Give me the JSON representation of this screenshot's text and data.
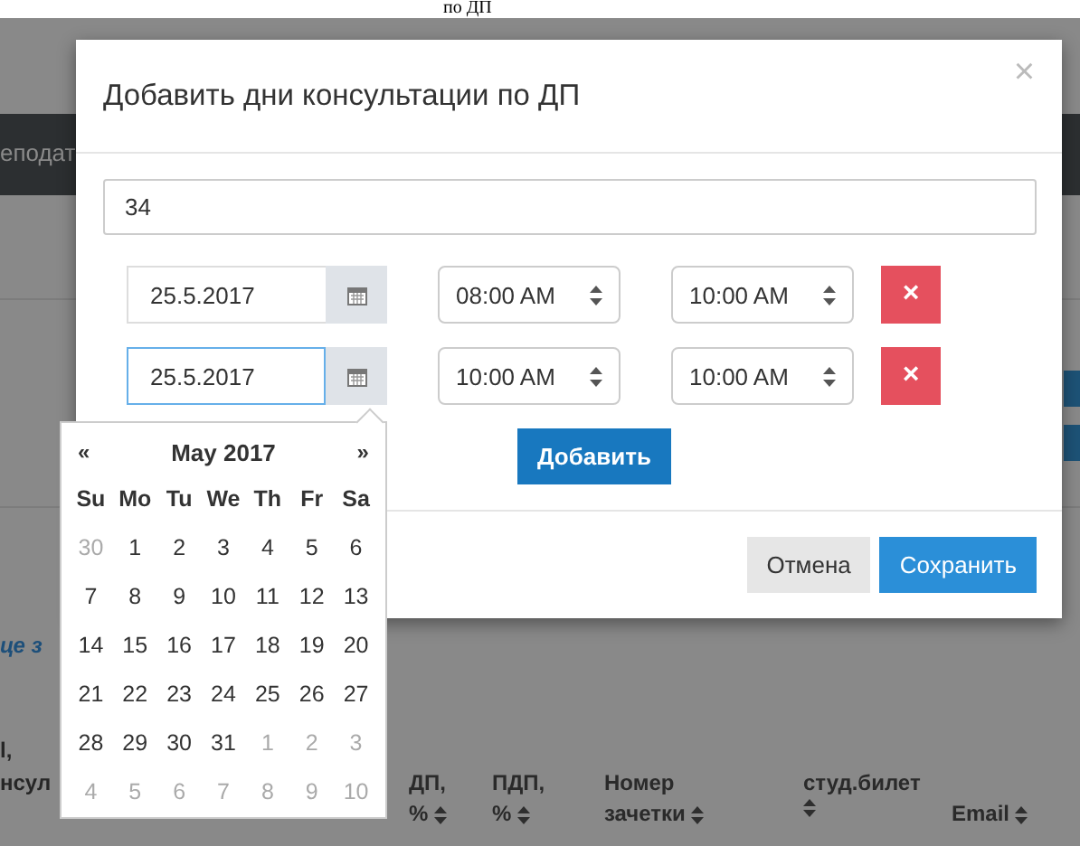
{
  "page_heading": "по ДП",
  "background": {
    "nav_text": "еподат",
    "link_text": "це з",
    "side_texts": [
      "l,",
      "нсул"
    ],
    "table_headers": [
      {
        "top": "ДП,",
        "bottom": "%"
      },
      {
        "top": "ПДП,",
        "bottom": "%"
      },
      {
        "top": "Номер",
        "bottom": "зачетки"
      },
      {
        "top": "студ.билет"
      },
      {
        "bottom": "Email"
      }
    ]
  },
  "modal": {
    "title": "Добавить дни консультации по ДП",
    "close": "×",
    "group_value": "34",
    "rows": [
      {
        "date": "25.5.2017",
        "focused": false,
        "time_from": "08:00 AM",
        "time_to": "10:00 AM",
        "remove": "×"
      },
      {
        "date": "25.5.2017",
        "focused": true,
        "time_from": "10:00 AM",
        "time_to": "10:00 AM",
        "remove": "×"
      }
    ],
    "add_button": "Добавить",
    "cancel_button": "Отмена",
    "save_button": "Сохранить"
  },
  "datepicker": {
    "prev": "«",
    "month": "May 2017",
    "next": "»",
    "weekdays": [
      "Su",
      "Mo",
      "Tu",
      "We",
      "Th",
      "Fr",
      "Sa"
    ],
    "weeks": [
      [
        {
          "day": "30",
          "other_month": true
        },
        {
          "day": "1",
          "other_month": false
        },
        {
          "day": "2",
          "other_month": false
        },
        {
          "day": "3",
          "other_month": false
        },
        {
          "day": "4",
          "other_month": false
        },
        {
          "day": "5",
          "other_month": false
        },
        {
          "day": "6",
          "other_month": false
        }
      ],
      [
        {
          "day": "7",
          "other_month": false
        },
        {
          "day": "8",
          "other_month": false
        },
        {
          "day": "9",
          "other_month": false
        },
        {
          "day": "10",
          "other_month": false
        },
        {
          "day": "11",
          "other_month": false
        },
        {
          "day": "12",
          "other_month": false
        },
        {
          "day": "13",
          "other_month": false
        }
      ],
      [
        {
          "day": "14",
          "other_month": false
        },
        {
          "day": "15",
          "other_month": false
        },
        {
          "day": "16",
          "other_month": false
        },
        {
          "day": "17",
          "other_month": false
        },
        {
          "day": "18",
          "other_month": false
        },
        {
          "day": "19",
          "other_month": false
        },
        {
          "day": "20",
          "other_month": false
        }
      ],
      [
        {
          "day": "21",
          "other_month": false
        },
        {
          "day": "22",
          "other_month": false
        },
        {
          "day": "23",
          "other_month": false
        },
        {
          "day": "24",
          "other_month": false
        },
        {
          "day": "25",
          "other_month": false
        },
        {
          "day": "26",
          "other_month": false
        },
        {
          "day": "27",
          "other_month": false
        }
      ],
      [
        {
          "day": "28",
          "other_month": false
        },
        {
          "day": "29",
          "other_month": false
        },
        {
          "day": "30",
          "other_month": false
        },
        {
          "day": "31",
          "other_month": false
        },
        {
          "day": "1",
          "other_month": true
        },
        {
          "day": "2",
          "other_month": true
        },
        {
          "day": "3",
          "other_month": true
        }
      ],
      [
        {
          "day": "4",
          "other_month": true
        },
        {
          "day": "5",
          "other_month": true
        },
        {
          "day": "6",
          "other_month": true
        },
        {
          "day": "7",
          "other_month": true
        },
        {
          "day": "8",
          "other_month": true
        },
        {
          "day": "9",
          "other_month": true
        },
        {
          "day": "10",
          "other_month": true
        }
      ]
    ]
  }
}
